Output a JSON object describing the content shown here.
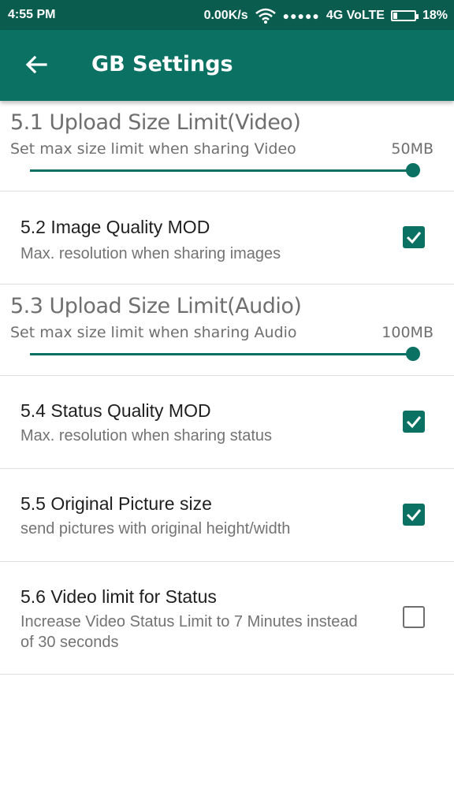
{
  "status_bar": {
    "time": "4:55 PM",
    "speed": "0.00K/s",
    "signal": "●●●●●",
    "network": "4G VoLTE",
    "battery": "18%",
    "battery_level": 0.18
  },
  "app_bar": {
    "title": "GB Settings",
    "back_icon": "arrow-left-icon",
    "color": "#0b7163",
    "status_color": "#0a5c4f"
  },
  "settings": {
    "video_limit": {
      "title": "5.1 Upload Size Limit(Video)",
      "summary": "Set max size limit when sharing Video",
      "value": "50MB",
      "level": 1.0
    },
    "image_quality": {
      "title": "5.2 Image Quality MOD",
      "summary": "Max. resolution when sharing images",
      "checked": true
    },
    "audio_limit": {
      "title": "5.3 Upload Size Limit(Audio)",
      "summary": "Set max size limit when sharing Audio",
      "value": "100MB",
      "level": 1.0
    },
    "status_quality": {
      "title": "5.4 Status Quality MOD",
      "summary": "Max. resolution when sharing status",
      "checked": true
    },
    "original_picture": {
      "title": "5.5 Original Picture size",
      "summary": "send pictures with original height/width",
      "checked": true
    },
    "video_status": {
      "title": "5.6 Video limit for Status",
      "summary": "Increase Video Status Limit to 7 Minutes instead of 30 seconds",
      "checked": false
    }
  }
}
